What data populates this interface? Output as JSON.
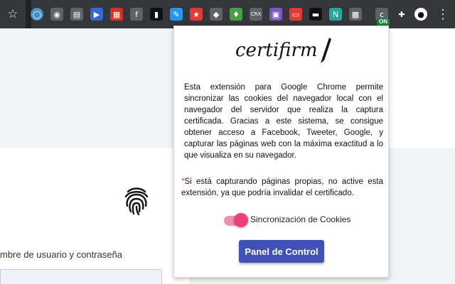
{
  "toolbar": {
    "extension_icons": [
      {
        "name": "circle-o-extension-icon",
        "glyph": "◯",
        "bg": "#4a90c2"
      },
      {
        "name": "camera-extension-icon",
        "glyph": "◉",
        "bg": "#5f6368"
      },
      {
        "name": "document-extension-icon",
        "glyph": "▤",
        "bg": "#5f6368"
      },
      {
        "name": "video-extension-icon",
        "glyph": "▶",
        "bg": "#3367d6"
      },
      {
        "name": "calendar-extension-icon",
        "glyph": "▦",
        "bg": "#d93025"
      },
      {
        "name": "formula-extension-icon",
        "glyph": "f",
        "bg": "#5f6368"
      },
      {
        "name": "bracket-extension-icon",
        "glyph": "▮",
        "bg": "#111111"
      },
      {
        "name": "eyedropper-extension-icon",
        "glyph": "✎",
        "bg": "#2196f3"
      },
      {
        "name": "badge-extension-icon",
        "glyph": "★",
        "bg": "#e53935"
      },
      {
        "name": "lightbulb-extension-icon",
        "glyph": "◆",
        "bg": "#5f6368"
      },
      {
        "name": "leaf-extension-icon",
        "glyph": "♦",
        "bg": "#43a047"
      },
      {
        "name": "crx-extension-icon",
        "glyph": "CRX",
        "bg": "#5f6368"
      },
      {
        "name": "square-extension-icon",
        "glyph": "▣",
        "bg": "#7e57c2"
      },
      {
        "name": "window-extension-icon",
        "glyph": "▭",
        "bg": "#e53935"
      },
      {
        "name": "terminal-extension-icon",
        "glyph": "▬",
        "bg": "#111111"
      },
      {
        "name": "n-extension-icon",
        "glyph": "N",
        "bg": "#26a69a"
      },
      {
        "name": "qr-extension-icon",
        "glyph": "▩",
        "bg": "#5f6368"
      },
      {
        "name": "certifirm-extension-icon",
        "glyph": "c",
        "bg": "#5f6368"
      },
      {
        "name": "puzzle-extensions-icon",
        "glyph": "✚",
        "bg": "#35363a"
      },
      {
        "name": "profile-avatar-icon",
        "glyph": "●",
        "bg": "#ffffff"
      }
    ],
    "on_badge": "ON",
    "menu_glyph": "⋮",
    "star_glyph": "☆"
  },
  "background_page": {
    "login_hint": "mbre de usuario y contraseña"
  },
  "popup": {
    "logo_text": "certifirm",
    "description": "Esta extensión para Google Chrome permite sincronizar las cookies del navegador local con el navegador del servidor que realiza la captura certificada. Gracias a este sistema, se consigue obtener acceso a Facebook, Tweeter, Google, y capturar las páginas web con la máxima exactitud a lo que visualiza en su navegador.",
    "note_asterisk": "*",
    "note": "Si está capturando páginas propias, no active esta extensión, ya que podría invalidar el certificado.",
    "toggle_label": "Sincronización de Cookies",
    "toggle_on": true,
    "panel_button": "Panel de Control",
    "accent_color": "#3f51b5",
    "toggle_color": "#ec407a"
  }
}
